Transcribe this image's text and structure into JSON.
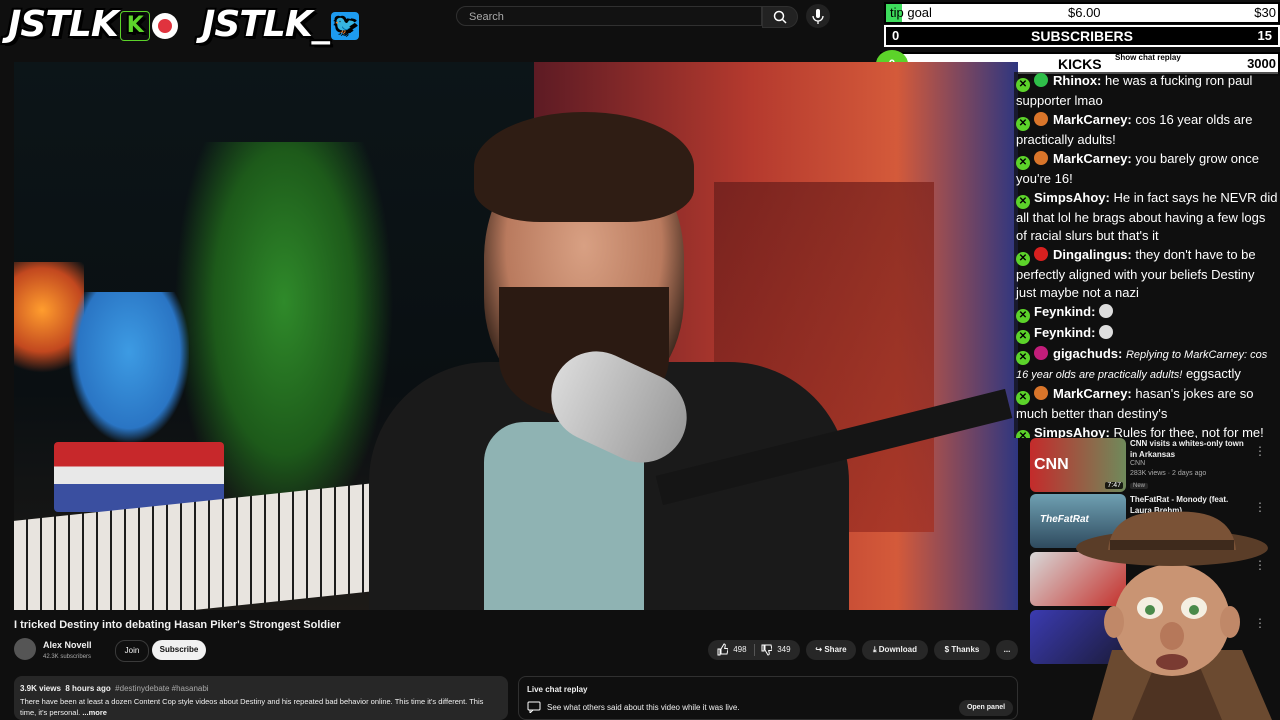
{
  "overlay": {
    "logo_kick": "JSTLK",
    "logo_twitter": "JSTLK_",
    "tip_goal_label": "tip goal",
    "tip_goal_current": "$6.00",
    "tip_goal_target": "$30",
    "tip_goal_progress": 0.2,
    "subscribers_label": "SUBSCRIBERS",
    "subscribers_current": "0",
    "subscribers_goal": "15",
    "kicks_label": "KICKS",
    "kicks_current": "0",
    "kicks_goal": "3000",
    "show_chat_replay": "Show chat replay"
  },
  "search": {
    "placeholder": "Search"
  },
  "chat": [
    {
      "user": "Rhinox:",
      "text": "he was a fucking ron paul supporter lmao",
      "avatar_color": "#2fbf4a"
    },
    {
      "user": "MarkCarney:",
      "text": "cos 16 year olds are practically adults!",
      "avatar_color": "#d9752a"
    },
    {
      "user": "MarkCarney:",
      "text": "you barely grow once you're 16!",
      "avatar_color": "#d9752a"
    },
    {
      "user": "SimpsAhoy:",
      "text": "He in fact says he NEVR did all that lol he brags about having a few logs of racial slurs but that's it",
      "avatar_color": ""
    },
    {
      "user": "Dingalingus:",
      "text": "they don't have to be perfectly aligned with your beliefs Destiny just maybe not a nazi",
      "avatar_color": "#d8201f"
    },
    {
      "user": "Feynkind:",
      "text": "",
      "avatar_color": ""
    },
    {
      "user": "Feynkind:",
      "text": "",
      "avatar_color": ""
    },
    {
      "user": "gigachuds:",
      "reply": "Replying to MarkCarney: cos 16 year olds are practically adults!",
      "text": "eggsactly",
      "avatar_color": "#c21d7a"
    },
    {
      "user": "MarkCarney:",
      "text": "hasan's jokes are so much better than destiny's",
      "avatar_color": "#d9752a"
    },
    {
      "user": "SimpsAhoy:",
      "text": "Rules for thee, not for me!",
      "avatar_color": ""
    }
  ],
  "recommendations": [
    {
      "title": "CNN visits a whites-only town in Arkansas",
      "channel": "CNN",
      "stats": "283K views · 2 days ago",
      "badge": "New",
      "duration": "7:47",
      "thumb_label": "CNN"
    },
    {
      "title": "TheFatRat - Monody (feat. Laura Brehm)",
      "channel": "",
      "stats": "",
      "badge": "",
      "duration": "",
      "thumb_label": "TheFatRat"
    },
    {
      "title": "",
      "channel": "",
      "stats": "",
      "badge": "",
      "duration": "",
      "thumb_label": ""
    },
    {
      "title": "",
      "channel": "",
      "stats": "",
      "badge": "",
      "duration": "",
      "thumb_label": ""
    }
  ],
  "video": {
    "title": "I tricked Destiny into debating Hasan Piker's Strongest Soldier",
    "channel_name": "Alex Novell",
    "channel_subs": "42.3K subscribers",
    "join_label": "Join",
    "subscribe_label": "Subscribe",
    "likes": "498",
    "dislikes": "349",
    "share_label": "Share",
    "download_label": "Download",
    "thanks_label": "Thanks",
    "more_label": "..."
  },
  "description": {
    "views": "3.9K views",
    "age": "8 hours ago",
    "tags": "#destinydebate #hasanabi",
    "text": "There have been at least a dozen Content Cop style videos about Destiny and his repeated bad behavior online. This time it's different. This time, it's personal.",
    "more": "...more"
  },
  "live_chat": {
    "title": "Live chat replay",
    "subtitle": "See what others said about this video while it was live.",
    "open_panel": "Open panel"
  },
  "colors": {
    "kick_green": "#5cd32a",
    "twitter_blue": "#1d9bf0",
    "tip_fill": "#3ddc5c"
  }
}
